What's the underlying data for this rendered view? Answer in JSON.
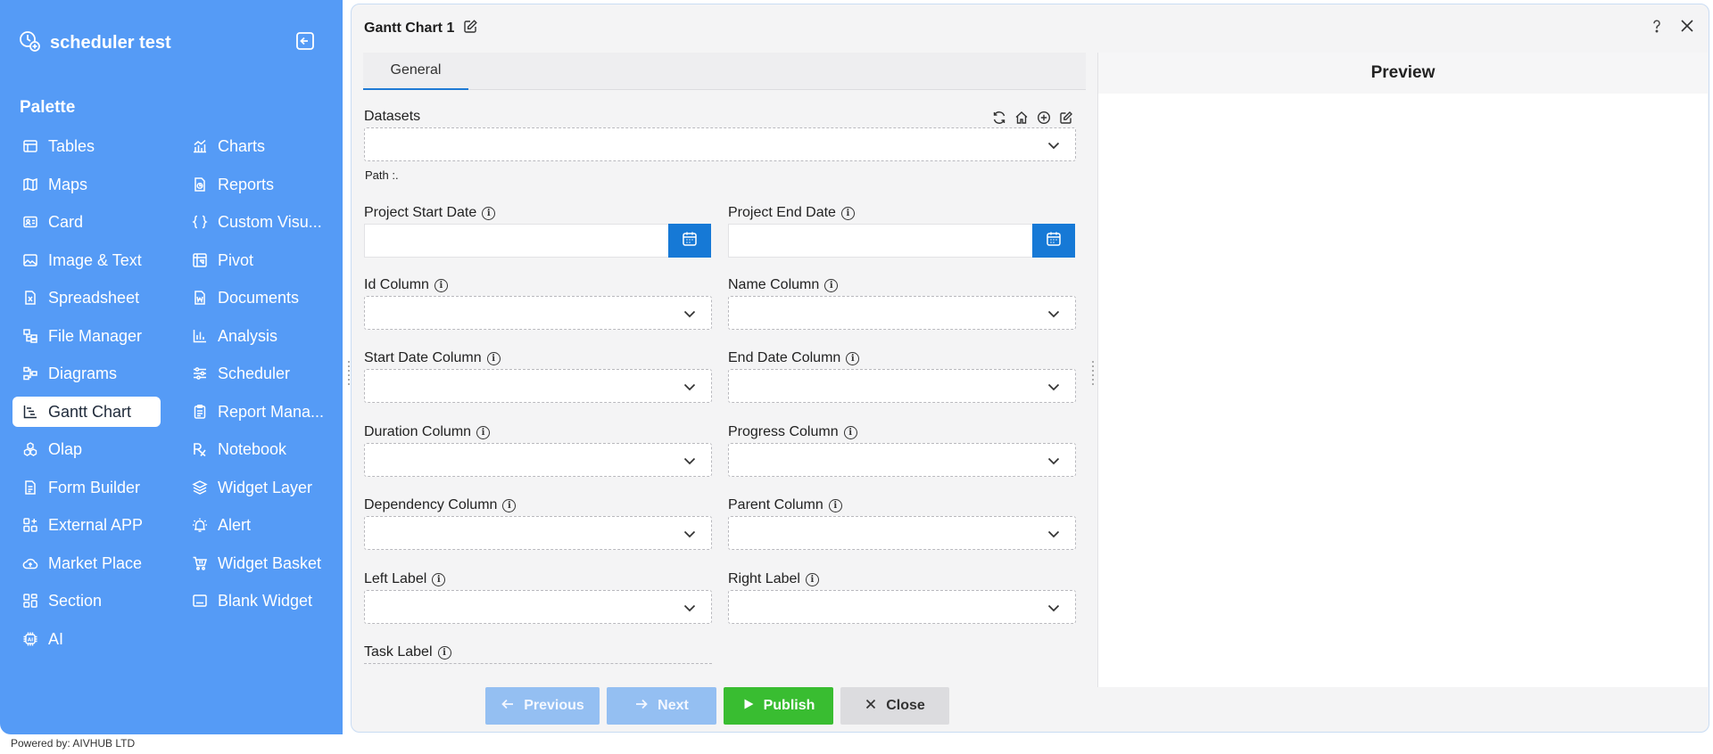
{
  "app": {
    "name": "scheduler test",
    "powered_by": "Powered by: AIVHUB LTD"
  },
  "palette": {
    "title": "Palette",
    "left_items": [
      {
        "label": "Tables",
        "icon": "table-icon"
      },
      {
        "label": "Maps",
        "icon": "map-icon"
      },
      {
        "label": "Card",
        "icon": "card-icon"
      },
      {
        "label": "Image & Text",
        "icon": "image-icon"
      },
      {
        "label": "Spreadsheet",
        "icon": "spreadsheet-icon"
      },
      {
        "label": "File Manager",
        "icon": "file-manager-icon"
      },
      {
        "label": "Diagrams",
        "icon": "diagram-icon"
      },
      {
        "label": "Gantt Chart",
        "icon": "gantt-icon",
        "active": true
      },
      {
        "label": "Olap",
        "icon": "olap-icon"
      },
      {
        "label": "Form Builder",
        "icon": "form-icon"
      },
      {
        "label": "External APP",
        "icon": "apps-icon"
      },
      {
        "label": "Market Place",
        "icon": "cloud-upload-icon"
      },
      {
        "label": "Section",
        "icon": "section-icon"
      },
      {
        "label": "AI",
        "icon": "ai-chip-icon"
      }
    ],
    "right_items": [
      {
        "label": "Charts",
        "icon": "chart-icon"
      },
      {
        "label": "Reports",
        "icon": "report-icon"
      },
      {
        "label": "Custom Visu...",
        "icon": "braces-icon"
      },
      {
        "label": "Pivot",
        "icon": "pivot-icon"
      },
      {
        "label": "Documents",
        "icon": "document-icon"
      },
      {
        "label": "Analysis",
        "icon": "analysis-icon"
      },
      {
        "label": "Scheduler",
        "icon": "sliders-icon"
      },
      {
        "label": "Report Mana...",
        "icon": "clipboard-icon"
      },
      {
        "label": "Notebook",
        "icon": "notebook-icon"
      },
      {
        "label": "Widget Layer",
        "icon": "layers-icon"
      },
      {
        "label": "Alert",
        "icon": "alarm-icon"
      },
      {
        "label": "Widget Basket",
        "icon": "basket-icon"
      },
      {
        "label": "Blank Widget",
        "icon": "blank-widget-icon"
      }
    ]
  },
  "editor": {
    "title": "Gantt Chart 1",
    "tab_general": "General",
    "preview_title": "Preview",
    "datasets_label": "Datasets",
    "path_label": "Path :.",
    "project_start_label": "Project Start Date",
    "project_end_label": "Project End Date",
    "fields": {
      "id_column": "Id Column",
      "name_column": "Name Column",
      "start_date_column": "Start Date Column",
      "end_date_column": "End Date Column",
      "duration_column": "Duration Column",
      "progress_column": "Progress Column",
      "dependency_column": "Dependency Column",
      "parent_column": "Parent Column",
      "left_label": "Left Label",
      "right_label": "Right Label",
      "task_label": "Task Label"
    },
    "buttons": {
      "previous": "Previous",
      "next": "Next",
      "publish": "Publish",
      "close": "Close"
    }
  },
  "colors": {
    "sidebar_bg": "#559bf6",
    "accent": "#1679d6",
    "publish": "#39bd31",
    "disabled": "#94bff2"
  }
}
